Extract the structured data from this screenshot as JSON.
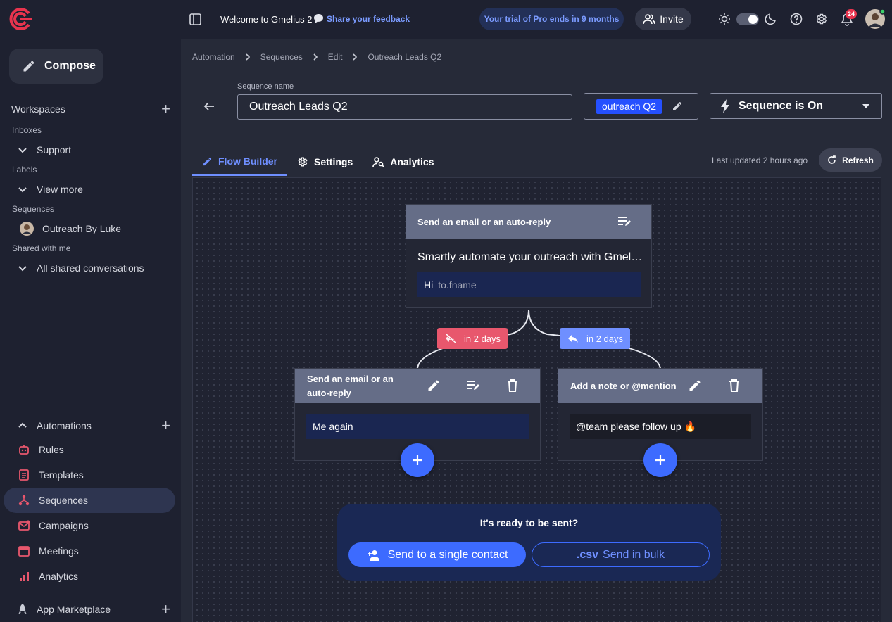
{
  "sidebar": {
    "compose_label": "Compose",
    "workspaces_label": "Workspaces",
    "inboxes_label": "Inboxes",
    "support_label": "Support",
    "labels_label": "Labels",
    "view_more_label": "View more",
    "sequences_label": "Sequences",
    "outreach_label": "Outreach By Luke",
    "shared_label": "Shared with me",
    "all_shared_label": "All shared conversations",
    "automations_label": "Automations",
    "nav": [
      {
        "label": "Rules",
        "icon": "robot-icon"
      },
      {
        "label": "Templates",
        "icon": "template-icon"
      },
      {
        "label": "Sequences",
        "icon": "sequence-icon",
        "active": true
      },
      {
        "label": "Campaigns",
        "icon": "campaign-icon"
      },
      {
        "label": "Meetings",
        "icon": "calendar-icon"
      },
      {
        "label": "Analytics",
        "icon": "analytics-icon"
      }
    ],
    "marketplace_label": "App Marketplace"
  },
  "topbar": {
    "welcome": "Welcome to Gmelius 2",
    "feedback": "Share your feedback",
    "trial": "Your trial of Pro ends in 9 months",
    "invite": "Invite",
    "notification_count": "24"
  },
  "breadcrumb": [
    "Automation",
    "Sequences",
    "Edit",
    "Outreach Leads Q2"
  ],
  "sequence": {
    "name_label": "Sequence name",
    "name_value": "Outreach Leads Q2",
    "tag": "outreach Q2",
    "status": "Sequence is On"
  },
  "tabs": [
    "Flow Builder",
    "Settings",
    "Analytics"
  ],
  "last_updated": "Last updated 2 hours ago",
  "refresh_label": "Refresh",
  "flow": {
    "root": {
      "title": "Send an email or an auto-reply",
      "preview": "Smartly automate your outreach with Gmel…",
      "greeting": "Hi",
      "greeting_var": "to.fname"
    },
    "branch_no_reply": "in 2 days",
    "branch_reply": "in 2 days",
    "left": {
      "title": "Send an email or an auto-reply",
      "body": "Me again"
    },
    "right": {
      "title": "Add a note or @mention",
      "body": "@team please follow up 🔥"
    }
  },
  "ready": {
    "title": "It's ready to be sent?",
    "single": "Send to a single contact",
    "bulk_prefix": ".csv",
    "bulk": "Send in bulk"
  },
  "colors": {
    "accent": "#3d6bff",
    "no_reply": "#e8576d",
    "reply": "#6f8fff",
    "brand": "#e8344e"
  }
}
